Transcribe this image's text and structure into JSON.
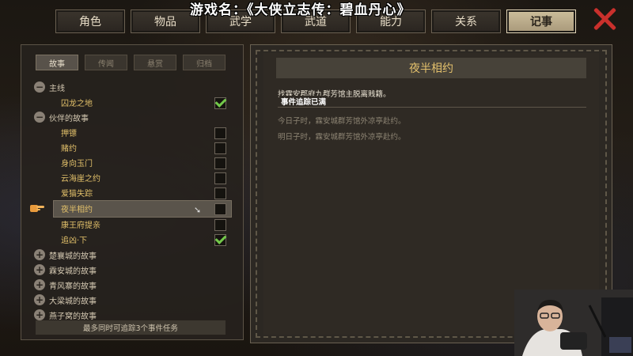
{
  "header": {
    "game_title": "游戏名：《大侠立志传：碧血丹心》",
    "tabs": [
      {
        "label": "角色",
        "active": false
      },
      {
        "label": "物品",
        "active": false
      },
      {
        "label": "武学",
        "active": false
      },
      {
        "label": "武道",
        "active": false
      },
      {
        "label": "能力",
        "active": false
      },
      {
        "label": "关系",
        "active": false
      },
      {
        "label": "记事",
        "active": true
      }
    ]
  },
  "left": {
    "subtabs": [
      {
        "label": "故事",
        "active": true
      },
      {
        "label": "传闻",
        "active": false
      },
      {
        "label": "悬赏",
        "active": false
      },
      {
        "label": "归档",
        "active": false
      }
    ],
    "tree": [
      {
        "type": "group",
        "label": "主线",
        "expanded": true
      },
      {
        "type": "item",
        "label": "囚龙之地",
        "checked": true
      },
      {
        "type": "group",
        "label": "伙伴的故事",
        "expanded": true
      },
      {
        "type": "item",
        "label": "押镖",
        "checked": false
      },
      {
        "type": "item",
        "label": "赌约",
        "checked": false
      },
      {
        "type": "item",
        "label": "身向玉门",
        "checked": false
      },
      {
        "type": "item",
        "label": "云海崖之约",
        "checked": false
      },
      {
        "type": "item",
        "label": "爱猫失踪",
        "checked": false
      },
      {
        "type": "item",
        "label": "夜半相约",
        "checked": false,
        "selected": true
      },
      {
        "type": "item",
        "label": "康王府提亲",
        "checked": false
      },
      {
        "type": "item",
        "label": "追凶·下",
        "checked": true
      },
      {
        "type": "group",
        "label": "楚襄城的故事",
        "expanded": false
      },
      {
        "type": "group",
        "label": "霖安城的故事",
        "expanded": false
      },
      {
        "type": "group",
        "label": "青风寨的故事",
        "expanded": false
      },
      {
        "type": "group",
        "label": "大梁城的故事",
        "expanded": false
      },
      {
        "type": "group",
        "label": "燕子窝的故事",
        "expanded": false
      }
    ],
    "footer_note": "最多同时可追踪3个事件任务"
  },
  "right": {
    "quest_title": "夜半相约",
    "description": "找霖安郡府九群芳馆主脱离贱籍。",
    "tooltip": "事件追踪已满",
    "clues": [
      "今日子时，霖安城群芳馆外凉亭赴约。",
      "明日子时，霖安城群芳馆外凉亭赴约。"
    ]
  },
  "colors": {
    "active_tab": "#cdbf9c",
    "item_text": "#e2c06a",
    "check_green": "#73c94a",
    "close_red": "#c9302c"
  }
}
